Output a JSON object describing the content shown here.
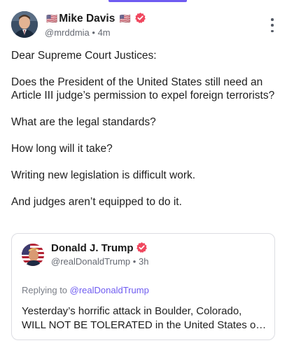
{
  "post": {
    "author": {
      "flag_left": "🇺🇸",
      "name": "Mike Davis",
      "flag_right": "🇺🇸",
      "handle": "@mrddmia",
      "separator": "•",
      "time": "4m",
      "verified_icon": "verified-badge-icon"
    },
    "menu_icon": "more-vertical-icon",
    "paragraphs": [
      "Dear Supreme Court Justices:",
      "Does the President of the United States still need an Article III judge’s permission to expel foreign terrorists?",
      "What are the legal standards?",
      "How long will it take?",
      "Writing new legislation is difficult work.",
      "And judges aren’t equipped to do it."
    ],
    "quoted": {
      "name": "Donald J. Trump",
      "handle": "@realDonaldTrump",
      "separator": "•",
      "time": "3h",
      "replying_prefix": "Replying to ",
      "replying_to": "@realDonaldTrump",
      "text_line1": "Yesterday’s horrific attack in Boulder, Colorado,",
      "text_line2": "WILL NOT BE TOLERATED in the United States o…"
    }
  },
  "colors": {
    "accent": "#6f5cf1",
    "verified": "#f0485f",
    "muted_text": "#666a73"
  }
}
